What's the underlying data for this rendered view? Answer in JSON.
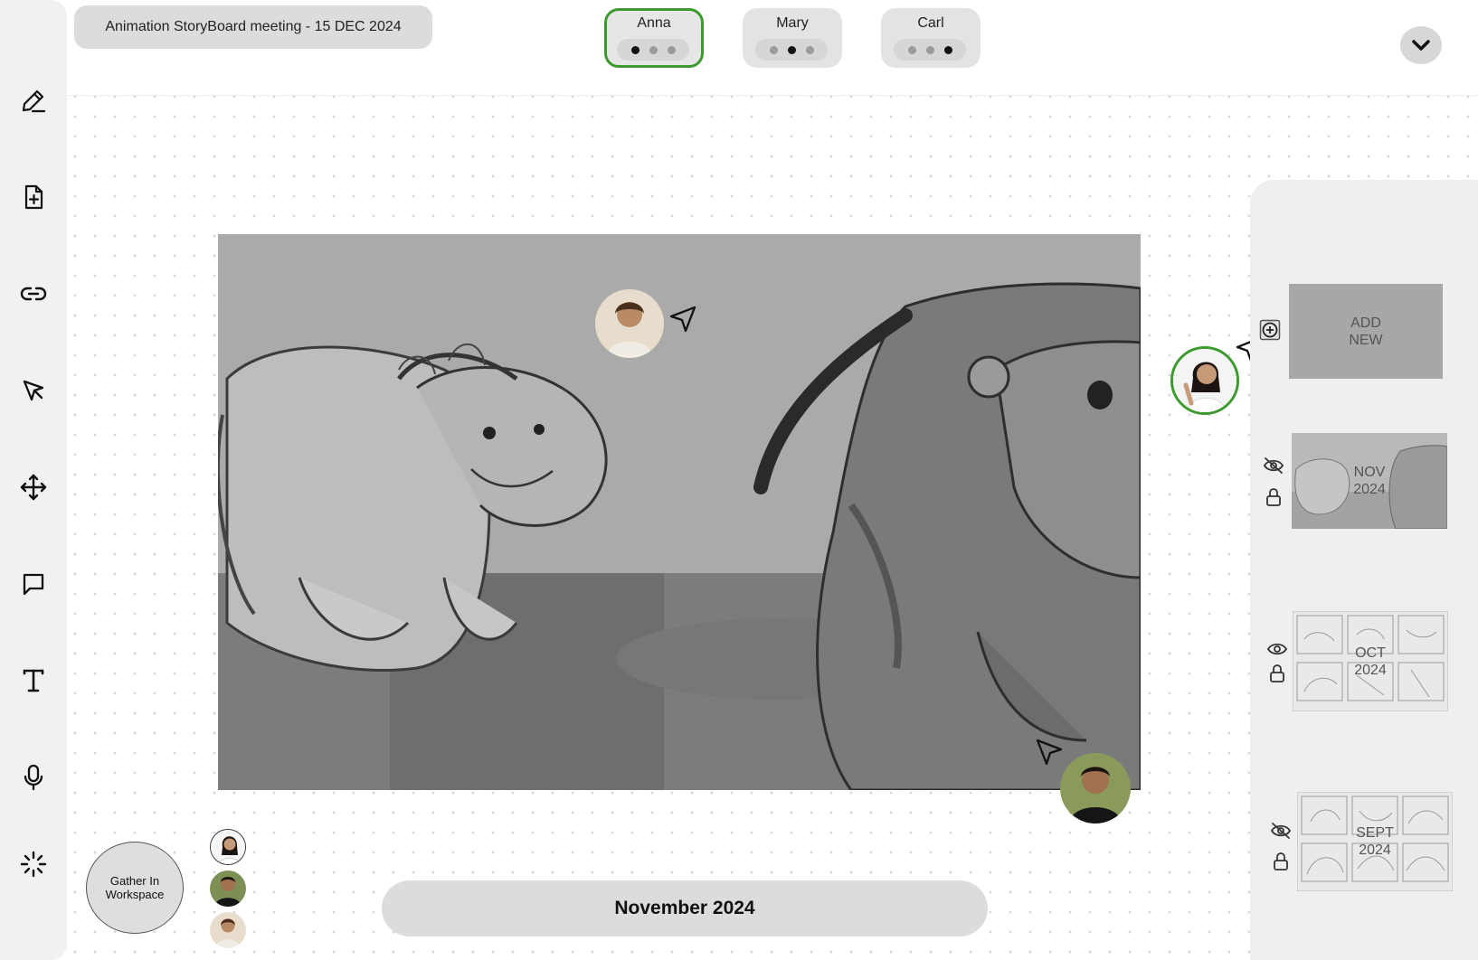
{
  "header": {
    "meeting_title": "Animation StoryBoard meeting - 15 DEC 2024",
    "participants": [
      {
        "name": "Anna",
        "active": true,
        "dots": [
          true,
          false,
          false
        ]
      },
      {
        "name": "Mary",
        "active": false,
        "dots": [
          false,
          true,
          false
        ]
      },
      {
        "name": "Carl",
        "active": false,
        "dots": [
          false,
          false,
          true
        ]
      }
    ],
    "collapse_icon": "chevron-down-icon"
  },
  "toolbar": {
    "tools": [
      {
        "name": "pen",
        "icon": "pen-icon"
      },
      {
        "name": "add-file",
        "icon": "file-plus-icon"
      },
      {
        "name": "link",
        "icon": "link-icon"
      },
      {
        "name": "select",
        "icon": "cursor-arrow-icon"
      },
      {
        "name": "move",
        "icon": "move-arrows-icon"
      },
      {
        "name": "comment",
        "icon": "speech-bubble-icon"
      },
      {
        "name": "text",
        "icon": "text-t-icon"
      },
      {
        "name": "microphone",
        "icon": "microphone-icon"
      },
      {
        "name": "loading",
        "icon": "loader-icon"
      }
    ]
  },
  "canvas": {
    "month_label": "November 2024",
    "gather_button": "Gather In Workspace"
  },
  "side_panel": {
    "add_new_label": "ADD\nNEW",
    "add_icon": "plus-square-icon",
    "boards": [
      {
        "label": "NOV\n2024",
        "visibility_icon": "eye-off-icon",
        "lock_icon": "lock-icon"
      },
      {
        "label": "OCT\n2024",
        "visibility_icon": "eye-icon",
        "lock_icon": "lock-icon"
      },
      {
        "label": "SEPT\n2024",
        "visibility_icon": "eye-off-icon",
        "lock_icon": "lock-icon"
      }
    ]
  },
  "colors": {
    "active_green": "#3c9a2f",
    "pill_grey": "#dcdcdc",
    "panel_grey": "#efefef",
    "sketch_grey": "#a8a8a8"
  }
}
